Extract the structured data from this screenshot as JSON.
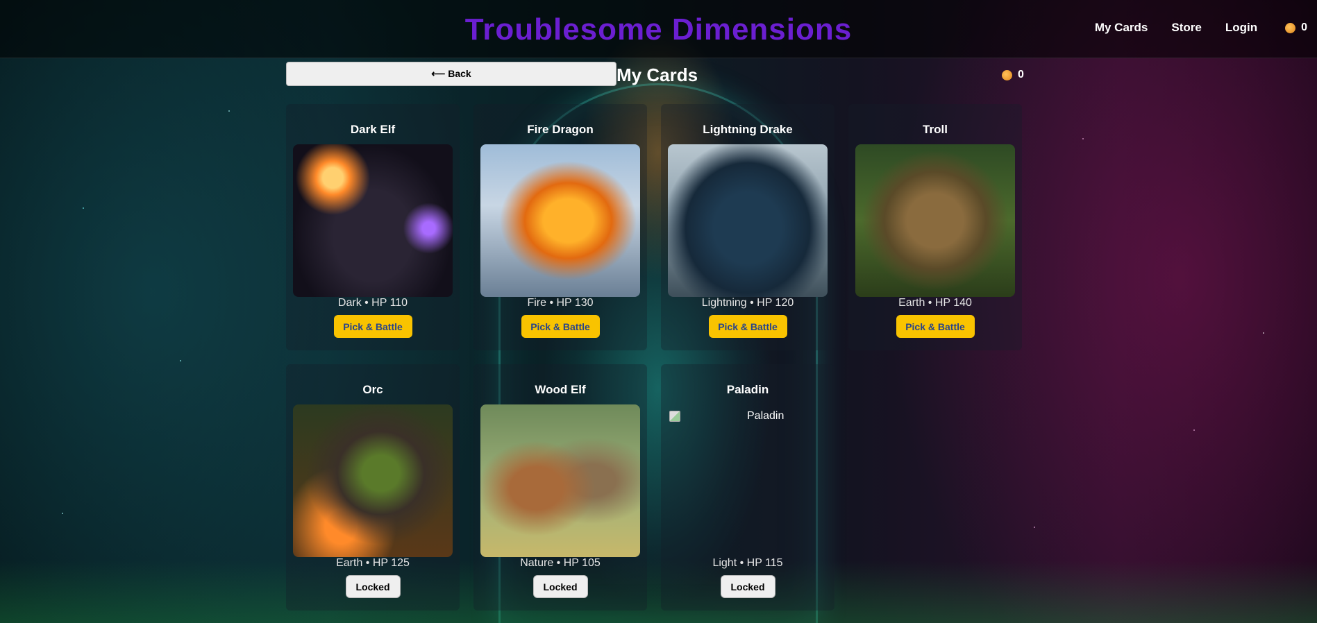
{
  "header": {
    "title": "Troublesome Dimensions",
    "nav": [
      "My Cards",
      "Store",
      "Login"
    ],
    "coins": "0"
  },
  "subheader": {
    "back_label": "⟵ Back",
    "page_title": "My Cards",
    "balance": "0"
  },
  "cards": [
    {
      "name": "Dark Elf",
      "stats": "Dark • HP 110",
      "button": "Pick & Battle",
      "locked": false
    },
    {
      "name": "Fire Dragon",
      "stats": "Fire • HP 130",
      "button": "Pick & Battle",
      "locked": false
    },
    {
      "name": "Lightning Drake",
      "stats": "Lightning • HP 120",
      "button": "Pick & Battle",
      "locked": false
    },
    {
      "name": "Troll",
      "stats": "Earth • HP 140",
      "button": "Pick & Battle",
      "locked": false
    },
    {
      "name": "Orc",
      "stats": "Earth • HP 125",
      "button": "Locked",
      "locked": true
    },
    {
      "name": "Wood Elf",
      "stats": "Nature • HP 105",
      "button": "Locked",
      "locked": true
    },
    {
      "name": "Paladin",
      "stats": "Light • HP 115",
      "button": "Locked",
      "locked": true,
      "image_alt": "Paladin"
    }
  ],
  "theme": {
    "brand_color": "#6b1fd1",
    "battle_button_color": "#f9c300",
    "coin_color": "#f0a030"
  }
}
